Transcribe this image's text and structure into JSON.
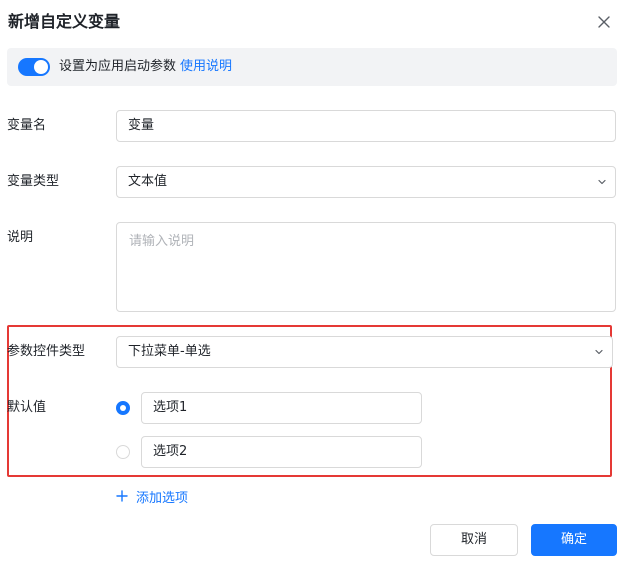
{
  "dialog": {
    "title": "新增自定义变量",
    "close_icon": "close-icon"
  },
  "banner": {
    "toggle_on": true,
    "text": "设置为应用启动参数",
    "link": "使用说明"
  },
  "form": {
    "name": {
      "label": "变量名",
      "value": "变量"
    },
    "type": {
      "label": "变量类型",
      "value": "文本值"
    },
    "description": {
      "label": "说明",
      "placeholder": "请输入说明"
    },
    "control_type": {
      "label": "参数控件类型",
      "value": "下拉菜单-单选"
    },
    "default_value": {
      "label": "默认值",
      "options": [
        {
          "value": "选项1",
          "selected": true
        },
        {
          "value": "选项2",
          "selected": false
        }
      ]
    },
    "add_option": "添加选项"
  },
  "footer": {
    "cancel": "取消",
    "confirm": "确定"
  },
  "colors": {
    "primary": "#1677ff",
    "highlight_border": "#e53935",
    "banner_bg": "#f2f3f5"
  }
}
